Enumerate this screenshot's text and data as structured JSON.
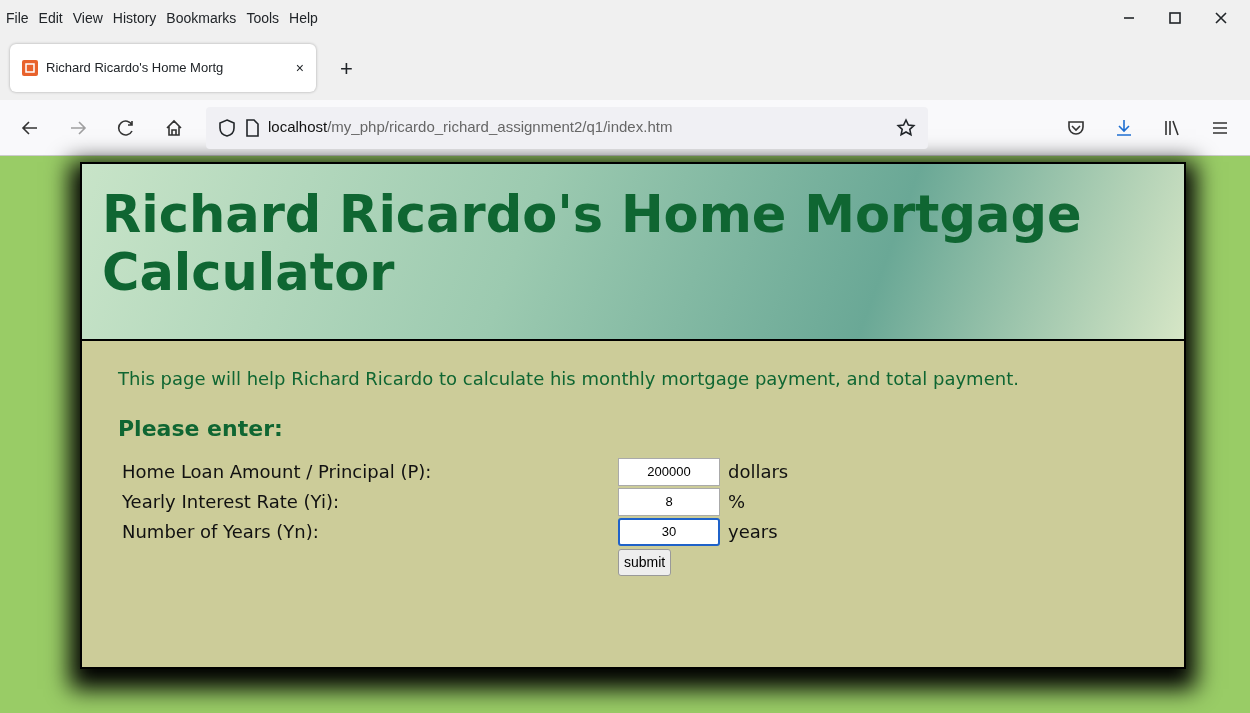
{
  "menu": [
    "File",
    "Edit",
    "View",
    "History",
    "Bookmarks",
    "Tools",
    "Help"
  ],
  "tabs": [
    {
      "title": "Richard Ricardo's Home Mortg",
      "selected": true,
      "close": "×"
    }
  ],
  "new_tab": "+",
  "address": {
    "host": "localhost",
    "path": "/my_php/ricardo_richard_assignment2/q1/index.htm"
  },
  "page": {
    "title": "Richard Ricardo's Home Mortgage Calculator",
    "intro": "This page will help Richard Ricardo to calculate his monthly mortgage payment, and total payment.",
    "heading": "Please enter:",
    "fields": [
      {
        "label": "Home Loan Amount / Principal (P):",
        "value": "200000",
        "unit": "dollars",
        "focused": false
      },
      {
        "label": "Yearly Interest Rate (Yi):",
        "value": "8",
        "unit": "%",
        "focused": false
      },
      {
        "label": "Number of Years (Yn):",
        "value": "30",
        "unit": "years",
        "focused": true
      }
    ],
    "submit": "submit"
  }
}
